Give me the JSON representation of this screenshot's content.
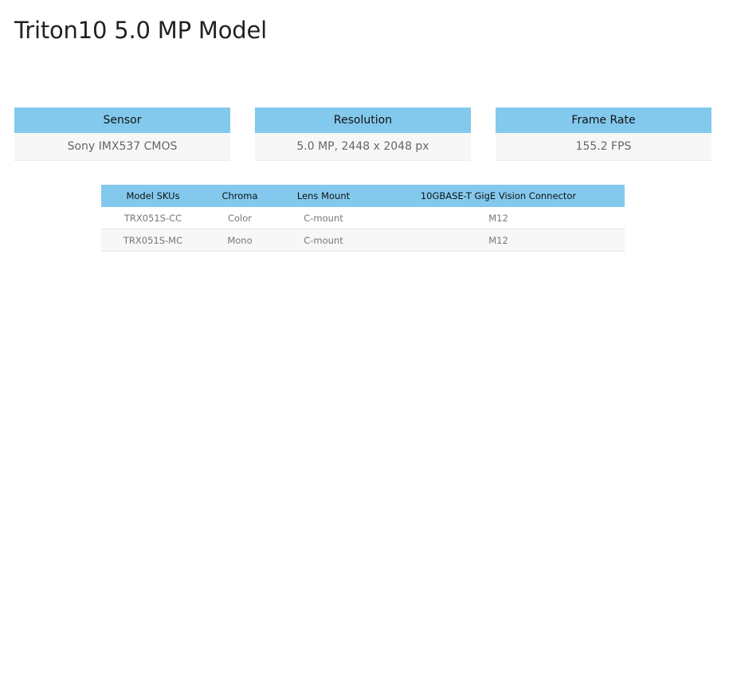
{
  "page": {
    "title": "Triton10 5.0 MP Model"
  },
  "specs": [
    {
      "label": "Sensor",
      "value": "Sony IMX537 CMOS"
    },
    {
      "label": "Resolution",
      "value": "5.0 MP, 2448 x 2048 px"
    },
    {
      "label": "Frame Rate",
      "value": "155.2 FPS"
    }
  ],
  "sku_table": {
    "columns": [
      "Model SKUs",
      "Chroma",
      "Lens Mount",
      "10GBASE-T GigE Vision Connector"
    ],
    "rows": [
      [
        "TRX051S-CC",
        "Color",
        "C-mount",
        "M12"
      ],
      [
        "TRX051S-MC",
        "Mono",
        "C-mount",
        "M12"
      ]
    ]
  },
  "colors": {
    "header_blue": "#83c9ed",
    "row_alt": "#f7f7f7"
  }
}
